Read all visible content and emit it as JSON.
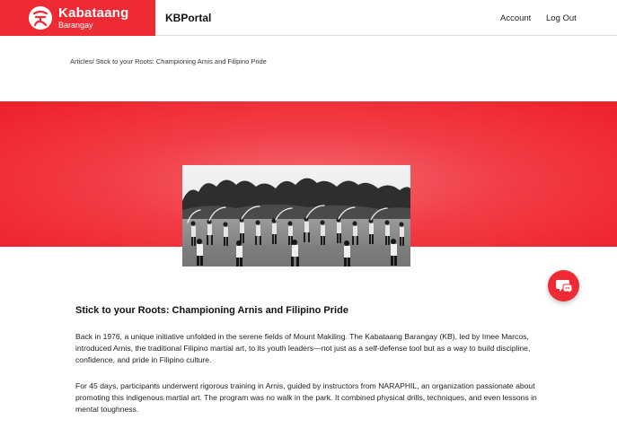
{
  "brand": {
    "name": "Kabataang",
    "subtitle": "Barangay",
    "color": "#ee2a35"
  },
  "header": {
    "portal_title": "KBPortal",
    "nav": {
      "account": "Account",
      "logout": "Log Out"
    }
  },
  "breadcrumb": {
    "parent": "Articles/",
    "current": " Stick to your Roots: Championing Arnis and Filipino Pride"
  },
  "hero": {
    "background_color": "#ee2a35",
    "photo_icon": "arnis-training-photo"
  },
  "article": {
    "title": "Stick to your Roots: Championing Arnis and Filipino Pride",
    "paragraphs": [
      "Back in 1976, a unique initiative unfolded in the serene fields of Mount Makiling. The  Kabataang Barangay (KB), led by Imee Marcos, introduced Arnis, the traditional Filipino martial  art, to its youth leaders—not just as a self-defense tool but as a way to build discipline,  confidence, and pride in Filipino culture.",
      "For 45 days, participants underwent rigorous training in Arnis, guided by instructors from  NARAPHIL, an organization passionate about promoting this indigenous martial art. The  program was no walk in the park. It combined physical drills, techniques, and even lessons in  mental toughness."
    ]
  },
  "chat": {
    "icon": "chat-bubble-icon"
  }
}
